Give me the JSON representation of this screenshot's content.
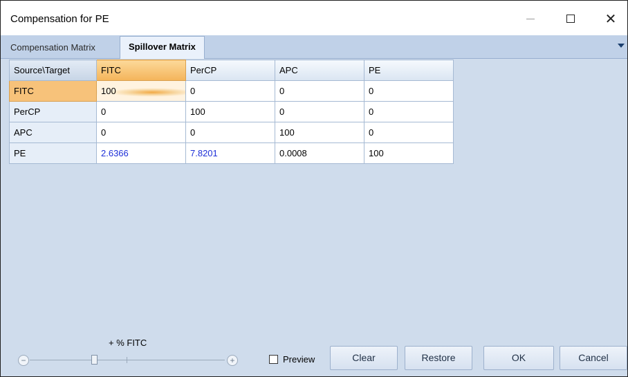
{
  "window": {
    "title": "Compensation for PE"
  },
  "tabs": [
    {
      "label": "Compensation Matrix",
      "active": false
    },
    {
      "label": "Spillover Matrix",
      "active": true
    }
  ],
  "matrix": {
    "corner_label": "Source\\Target",
    "columns": [
      "FITC",
      "PerCP",
      "APC",
      "PE"
    ],
    "rows": [
      {
        "label": "FITC",
        "values": [
          "100",
          "0",
          "0",
          "0"
        ]
      },
      {
        "label": "PerCP",
        "values": [
          "0",
          "100",
          "0",
          "0"
        ]
      },
      {
        "label": "APC",
        "values": [
          "0",
          "0",
          "100",
          "0"
        ]
      },
      {
        "label": "PE",
        "values": [
          "2.6366",
          "7.8201",
          "0.0008",
          "100"
        ]
      }
    ],
    "selected_row": "FITC",
    "selected_column": "FITC",
    "highlight_color": "#f4b45a",
    "modified_value_color": "#1d2fd8"
  },
  "slider": {
    "label": "+ % FITC",
    "minus_glyph": "−",
    "plus_glyph": "+"
  },
  "preview": {
    "label": "Preview",
    "checked": false
  },
  "buttons": {
    "clear": "Clear",
    "restore": "Restore",
    "ok": "OK",
    "cancel": "Cancel"
  }
}
